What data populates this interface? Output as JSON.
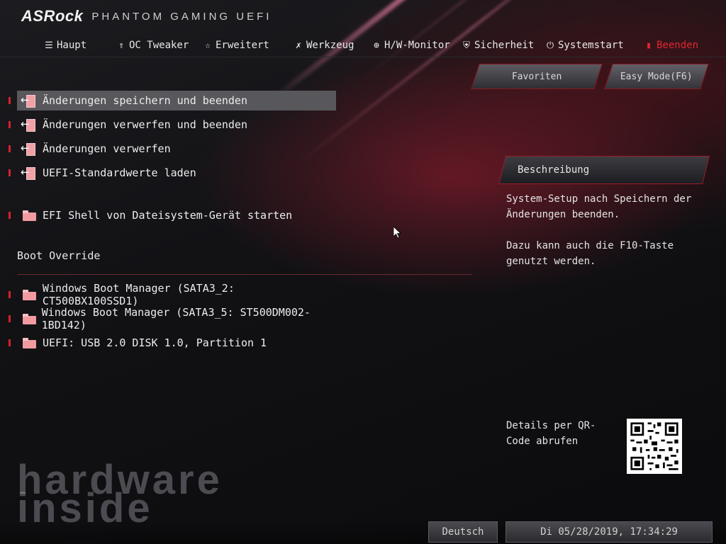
{
  "brand": {
    "logo": "ASRock",
    "subtitle": "PHANTOM GAMING UEFI"
  },
  "nav": {
    "items": [
      {
        "label": "Haupt",
        "icon": "list-icon"
      },
      {
        "label": "OC Tweaker",
        "icon": "rocket-icon"
      },
      {
        "label": "Erweitert",
        "icon": "star-icon"
      },
      {
        "label": "Werkzeug",
        "icon": "tools-icon"
      },
      {
        "label": "H/W-Monitor",
        "icon": "crosshair-icon"
      },
      {
        "label": "Sicherheit",
        "icon": "shield-icon"
      },
      {
        "label": "Systemstart",
        "icon": "power-icon"
      },
      {
        "label": "Beenden",
        "icon": "exit-door-icon",
        "active": true
      }
    ]
  },
  "buttons": {
    "favorites": "Favoriten",
    "easy_mode": "Easy Mode(F6)"
  },
  "menu": {
    "items": [
      {
        "label": "Änderungen speichern und beenden",
        "icon": "exit-icon",
        "selected": true
      },
      {
        "label": "Änderungen verwerfen und beenden",
        "icon": "exit-icon"
      },
      {
        "label": "Änderungen verwerfen",
        "icon": "exit-icon"
      },
      {
        "label": "UEFI-Standardwerte laden",
        "icon": "exit-icon"
      },
      {
        "label": "EFI Shell von Dateisystem-Gerät starten",
        "icon": "folder-icon"
      }
    ],
    "boot_override_title": "Boot Override",
    "boot_items": [
      {
        "label": "Windows Boot Manager (SATA3_2: CT500BX100SSD1)",
        "icon": "folder-icon"
      },
      {
        "label": "Windows Boot Manager (SATA3_5: ST500DM002-1BD142)",
        "icon": "folder-icon"
      },
      {
        "label": "UEFI: USB 2.0 DISK 1.0, Partition 1",
        "icon": "folder-icon"
      }
    ]
  },
  "description": {
    "title": "Beschreibung",
    "line1": "System-Setup nach Speichern der Änderungen beenden.",
    "line2": "Dazu kann auch die F10-Taste genutzt werden."
  },
  "qr": {
    "label": "Details per QR-Code abrufen"
  },
  "watermark": {
    "text": "hardware inside"
  },
  "footer": {
    "language": "Deutsch",
    "datetime": "Di 05/28/2019, 17:34:29"
  },
  "colors": {
    "accent": "#e0262f",
    "selected_bg": "#57575c"
  }
}
